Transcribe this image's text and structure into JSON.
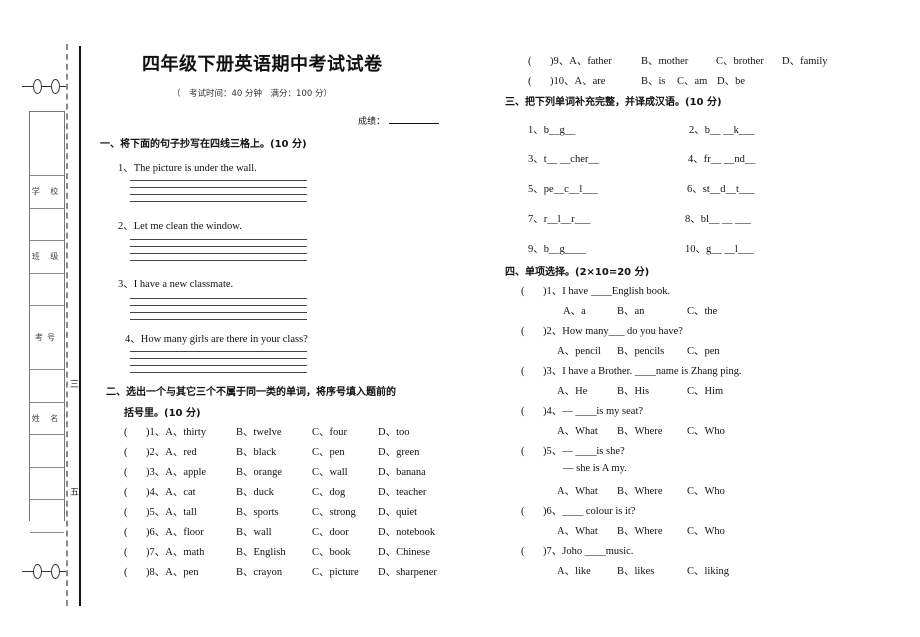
{
  "margin": {
    "fields": [
      "学 校",
      "班 级",
      "考号",
      "姓 名"
    ],
    "marks": [
      "三",
      "五"
    ]
  },
  "header": {
    "title": "四年级下册英语期中考试试卷",
    "subtitle": "（　考试时间：40 分钟　满分：100 分）",
    "score_label": "成绩："
  },
  "section1": {
    "heading": "一、将下面的句子抄写在四线三格上。(10 分)",
    "items": [
      "1、The picture is under the wall.",
      "2、Let me clean the window.",
      "3、I have a new classmate.",
      "4、How many girls are there in your class?"
    ]
  },
  "section2": {
    "heading_line1": "二、选出一个与其它三个不属于同一类的单词，将序号填入题前的",
    "heading_line2": "括号里。(10 分)",
    "paren": "(　　)",
    "items": [
      {
        "num": ")1、A、thirty",
        "b": "B、twelve",
        "c": "C、four",
        "d": "D、too"
      },
      {
        "num": ")2、A、red",
        "b": "B、black",
        "c": "C、pen",
        "d": "D、green"
      },
      {
        "num": ")3、A、apple",
        "b": "B、orange",
        "c": "C、wall",
        "d": "D、banana"
      },
      {
        "num": ")4、A、cat",
        "b": "B、duck",
        "c": "C、dog",
        "d": "D、teacher"
      },
      {
        "num": ")5、A、tall",
        "b": "B、sports",
        "c": "C、strong",
        "d": "D、quiet"
      },
      {
        "num": ")6、A、floor",
        "b": "B、wall",
        "c": "C、door",
        "d": "D、notebook"
      },
      {
        "num": ")7、A、math",
        "b": "B、English",
        "c": "C、book",
        "d": "D、Chinese"
      },
      {
        "num": ")8、A、pen",
        "b": "B、crayon",
        "c": "C、picture",
        "d": "D、sharpener"
      },
      {
        "num": ")9、A、father",
        "b": "B、mother",
        "c": "C、brother",
        "d": "D、family"
      },
      {
        "num": ")10、A、are",
        "b": "B、is",
        "c": "C、am",
        "d": "D、be"
      }
    ]
  },
  "section3": {
    "heading": "三、把下列单词补充完整，并译成汉语。(10 分)",
    "items": [
      "1、b__g__",
      "2、b__ __k___",
      "3、t__ __cher__",
      "4、fr__ __nd__",
      "5、pe__c__l___",
      "6、st__d__t___",
      "7、r__l__r___",
      "8、bl__ __ ___",
      "9、b__g____",
      "10、g__ __l___"
    ]
  },
  "section4": {
    "heading": "四、单项选择。(2×10=20 分)",
    "paren": "(　　",
    "items": [
      {
        "q": ")1、I have ____English book.",
        "a": "A、a",
        "b": "B、an",
        "c": "C、the"
      },
      {
        "q": ")2、How many___ do you have?",
        "a": "A、pencil",
        "b": "B、pencils",
        "c": "C、pen"
      },
      {
        "q": ")3、I have a Brother. ____name is Zhang ping.",
        "a": "A、He",
        "b": "B、His",
        "c": "C、Him"
      },
      {
        "q": ")4、— ____is my seat?",
        "a": "A、What",
        "b": "B、Where",
        "c": "C、Who"
      },
      {
        "q": ")5、— ____is she?",
        "extra": "— she is A my.",
        "a": "A、What",
        "b": "B、Where",
        "c": "C、Who"
      },
      {
        "q": ")6、____ colour is it?",
        "a": "A、What",
        "b": "B、Where",
        "c": "C、Who"
      },
      {
        "q": ")7、Joho ____music.",
        "a": "A、like",
        "b": "B、likes",
        "c": "C、liking"
      }
    ]
  }
}
